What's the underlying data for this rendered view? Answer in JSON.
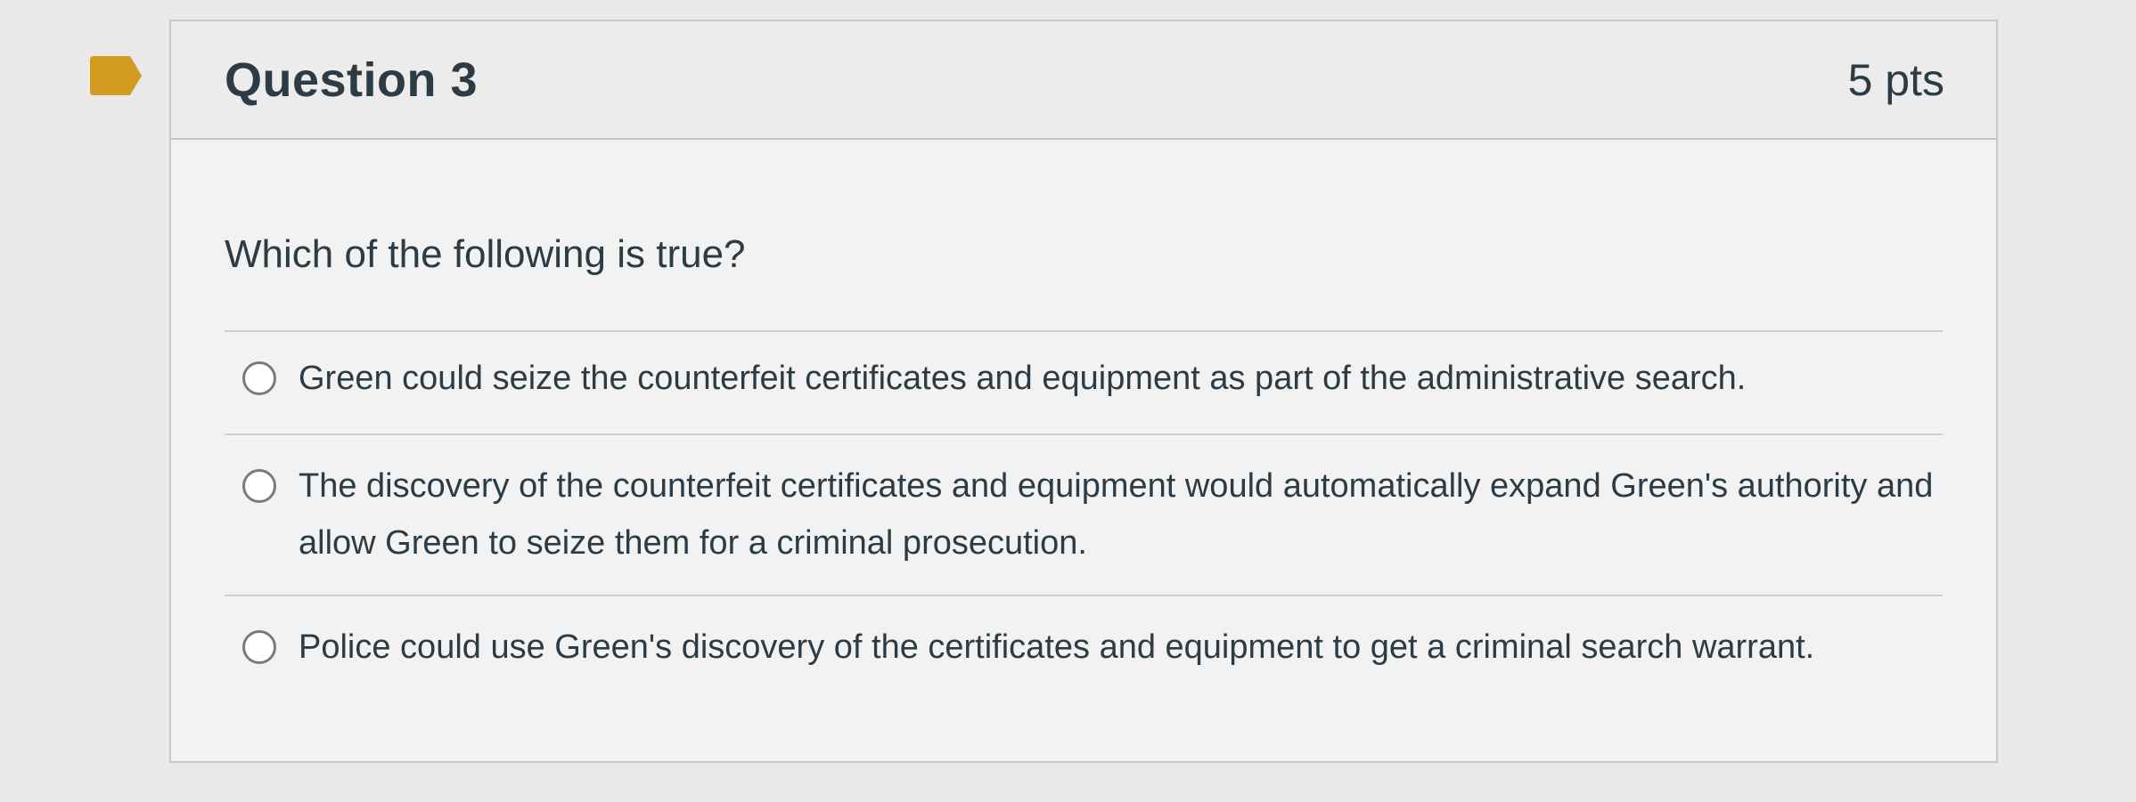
{
  "question": {
    "title": "Question 3",
    "points": "5 pts",
    "prompt": "Which of the following is true?",
    "answers": [
      {
        "label": "Green could seize the counterfeit certificates and equipment as part of the administrative search."
      },
      {
        "label": "The discovery of the counterfeit certificates and equipment would automatically expand Green's authority and allow Green to seize them for a criminal prosecution."
      },
      {
        "label": "Police could use Green's discovery of the certificates and equipment to get a criminal search warrant."
      }
    ]
  },
  "colors": {
    "bookmark": "#d39b1f",
    "text": "#2d3b45",
    "border": "#c8c8c8",
    "background": "#e9e9e9"
  },
  "icons": {
    "bookmark": "bookmark-flag-icon",
    "radio": "radio-button-icon"
  }
}
